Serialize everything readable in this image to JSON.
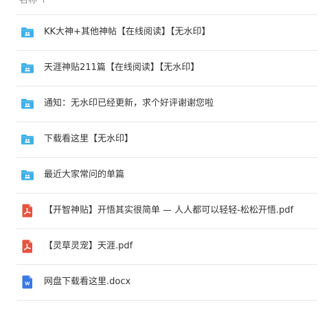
{
  "header": {
    "column_label": "名称 ↑"
  },
  "files": [
    {
      "name": "KK大神+其他神帖【在线阅读】【无水印】",
      "type": "folder",
      "icon": "shared-folder-icon"
    },
    {
      "name": "天涯神贴211篇【在线阅读】【无水印】",
      "type": "folder",
      "icon": "shared-folder-icon"
    },
    {
      "name": "通知：无水印已经更新，求个好评谢谢您啦",
      "type": "folder",
      "icon": "shared-folder-icon"
    },
    {
      "name": "下载看这里【无水印】",
      "type": "folder",
      "icon": "shared-folder-icon"
    },
    {
      "name": "最近大家常问的单篇",
      "type": "folder",
      "icon": "shared-folder-icon"
    },
    {
      "name": "【开智神贴】开悟其实很简单 — 人人都可以轻轻-松松开悟.pdf",
      "type": "pdf",
      "icon": "pdf-file-icon"
    },
    {
      "name": "【灵草灵宠】天涯.pdf",
      "type": "pdf",
      "icon": "pdf-file-icon"
    },
    {
      "name": "网盘下载看这里.docx",
      "type": "word",
      "icon": "word-file-icon"
    }
  ],
  "colors": {
    "folder": "#3eb0e8",
    "pdf": "#e5533f",
    "word": "#3a78e4",
    "divider": "#e8e8e8"
  }
}
